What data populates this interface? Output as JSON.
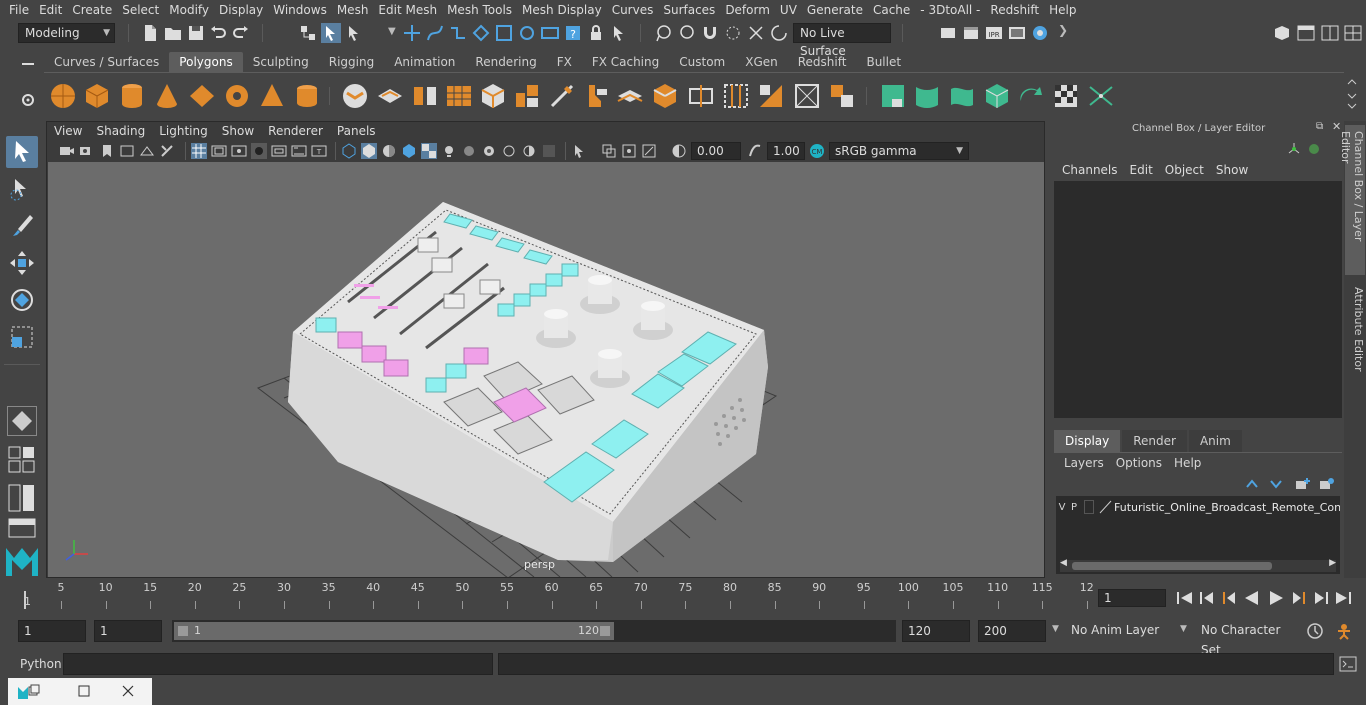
{
  "menu": [
    "File",
    "Edit",
    "Create",
    "Select",
    "Modify",
    "Display",
    "Windows",
    "Mesh",
    "Edit Mesh",
    "Mesh Tools",
    "Mesh Display",
    "Curves",
    "Surfaces",
    "Deform",
    "UV",
    "Generate",
    "Cache",
    "- 3DtoAll -",
    "Redshift",
    "Help"
  ],
  "status": {
    "mode": "Modeling",
    "live_surface": "No Live Surface"
  },
  "shelf": {
    "tabs": [
      "Curves / Surfaces",
      "Polygons",
      "Sculpting",
      "Rigging",
      "Animation",
      "Rendering",
      "FX",
      "FX Caching",
      "Custom",
      "XGen",
      "Redshift",
      "Bullet"
    ],
    "active": "Polygons"
  },
  "viewport": {
    "menu": [
      "View",
      "Shading",
      "Lighting",
      "Show",
      "Renderer",
      "Panels"
    ],
    "exposure": "0.00",
    "gamma": "1.00",
    "color_space": "sRGB gamma",
    "camera_label": "persp"
  },
  "channel_box": {
    "title": "Channel Box / Layer Editor",
    "menu": [
      "Channels",
      "Edit",
      "Object",
      "Show"
    ],
    "layer_tabs": [
      "Display",
      "Render",
      "Anim"
    ],
    "layer_menu": [
      "Layers",
      "Options",
      "Help"
    ],
    "layer": {
      "v": "V",
      "p": "P",
      "name": "Futuristic_Online_Broadcast_Remote_Contr"
    },
    "side_tabs": [
      "Channel Box / Layer Editor",
      "Attribute Editor"
    ]
  },
  "timeline": {
    "ticks": [
      "5",
      "10",
      "15",
      "20",
      "25",
      "30",
      "35",
      "40",
      "45",
      "50",
      "55",
      "60",
      "65",
      "70",
      "75",
      "80",
      "85",
      "90",
      "95",
      "100",
      "105",
      "110",
      "115",
      "12"
    ],
    "start_label": "1",
    "current_frame": "1"
  },
  "range": {
    "start": "1",
    "playback_start": "1",
    "slider_start": "1",
    "slider_end": "120",
    "playback_end": "120",
    "end": "200",
    "anim_layer": "No Anim Layer",
    "character_set": "No Character Set"
  },
  "command": {
    "language": "Python"
  },
  "colors": {
    "accent": "#5a7fa0",
    "shelf_green": "#3fb98f",
    "shelf_orange": "#e08a2c",
    "glow_cyan": "#8ef0f0",
    "glow_pink": "#f0a0e8"
  }
}
